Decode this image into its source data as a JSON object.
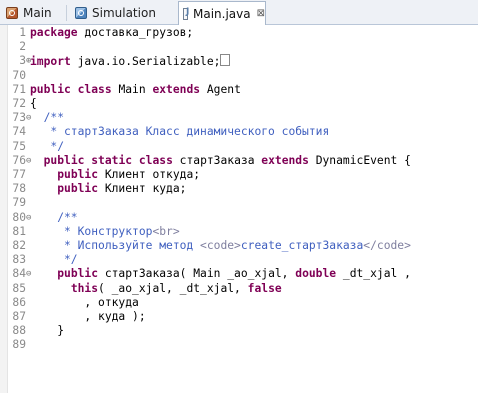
{
  "tabs": [
    {
      "label": "Main",
      "icon": "agent-type-icon",
      "active": false
    },
    {
      "label": "Simulation",
      "icon": "experiment-icon",
      "active": false
    },
    {
      "label": "Main.java",
      "icon": "java-file-icon",
      "active": true,
      "close": "⊠"
    }
  ],
  "editor": {
    "lines": [
      {
        "num": "1",
        "parts": [
          {
            "t": "package",
            "c": "kw"
          },
          {
            "t": " доставка_грузов;"
          }
        ]
      },
      {
        "num": "2",
        "parts": [
          {
            "t": ""
          }
        ]
      },
      {
        "num": "3",
        "fold": "⊕",
        "parts": [
          {
            "t": "import",
            "c": "kw"
          },
          {
            "t": " java.io.Serializable;"
          }
        ],
        "foldbox": true
      },
      {
        "num": "70",
        "parts": [
          {
            "t": ""
          }
        ]
      },
      {
        "num": "71",
        "parts": [
          {
            "t": "public",
            "c": "kw"
          },
          {
            "t": " "
          },
          {
            "t": "class",
            "c": "kw"
          },
          {
            "t": " Main "
          },
          {
            "t": "extends",
            "c": "kw"
          },
          {
            "t": " Agent"
          }
        ]
      },
      {
        "num": "72",
        "parts": [
          {
            "t": "{"
          }
        ]
      },
      {
        "num": "73",
        "fold": "⊖",
        "parts": [
          {
            "t": "  /**",
            "c": "cm"
          }
        ]
      },
      {
        "num": "74",
        "parts": [
          {
            "t": "   * стартЗаказа Класс динамического события",
            "c": "cm"
          }
        ]
      },
      {
        "num": "75",
        "parts": [
          {
            "t": "   */",
            "c": "cm"
          }
        ]
      },
      {
        "num": "76",
        "fold": "⊖",
        "parts": [
          {
            "t": "  "
          },
          {
            "t": "public",
            "c": "kw"
          },
          {
            "t": " "
          },
          {
            "t": "static",
            "c": "kw"
          },
          {
            "t": " "
          },
          {
            "t": "class",
            "c": "kw"
          },
          {
            "t": " стартЗаказа "
          },
          {
            "t": "extends",
            "c": "kw"
          },
          {
            "t": " DynamicEvent {"
          }
        ]
      },
      {
        "num": "77",
        "parts": [
          {
            "t": "    "
          },
          {
            "t": "public",
            "c": "kw"
          },
          {
            "t": " Клиент откуда;"
          }
        ]
      },
      {
        "num": "78",
        "parts": [
          {
            "t": "    "
          },
          {
            "t": "public",
            "c": "kw"
          },
          {
            "t": " Клиент куда;"
          }
        ]
      },
      {
        "num": "79",
        "parts": [
          {
            "t": ""
          }
        ]
      },
      {
        "num": "80",
        "fold": "⊖",
        "parts": [
          {
            "t": "    /**",
            "c": "cm"
          }
        ]
      },
      {
        "num": "81",
        "parts": [
          {
            "t": "     * Конструктор",
            "c": "cm"
          },
          {
            "t": "<br>",
            "c": "tag"
          }
        ]
      },
      {
        "num": "82",
        "parts": [
          {
            "t": "     * Используйте метод ",
            "c": "cm"
          },
          {
            "t": "<code>",
            "c": "tag"
          },
          {
            "t": "create_стартЗаказа",
            "c": "cm"
          },
          {
            "t": "</code>",
            "c": "tag"
          }
        ]
      },
      {
        "num": "83",
        "parts": [
          {
            "t": "     */",
            "c": "cm"
          }
        ]
      },
      {
        "num": "84",
        "fold": "⊖",
        "parts": [
          {
            "t": "    "
          },
          {
            "t": "public",
            "c": "kw"
          },
          {
            "t": " стартЗаказа( Main _ao_xjal, "
          },
          {
            "t": "double",
            "c": "kw"
          },
          {
            "t": " _dt_xjal ,"
          }
        ]
      },
      {
        "num": "85",
        "parts": [
          {
            "t": "      "
          },
          {
            "t": "this",
            "c": "kw"
          },
          {
            "t": "( _ao_xjal, _dt_xjal, "
          },
          {
            "t": "false",
            "c": "kw"
          }
        ]
      },
      {
        "num": "86",
        "parts": [
          {
            "t": "        , откуда"
          }
        ]
      },
      {
        "num": "87",
        "parts": [
          {
            "t": "        , куда );"
          }
        ]
      },
      {
        "num": "88",
        "parts": [
          {
            "t": "    }"
          }
        ]
      },
      {
        "num": "89",
        "parts": [
          {
            "t": ""
          }
        ]
      }
    ]
  },
  "colors": {
    "keyword": "#7f0055",
    "comment": "#3f5fbf",
    "javadoc_tag": "#7f7f9f",
    "line_number": "#8a8a8a"
  }
}
